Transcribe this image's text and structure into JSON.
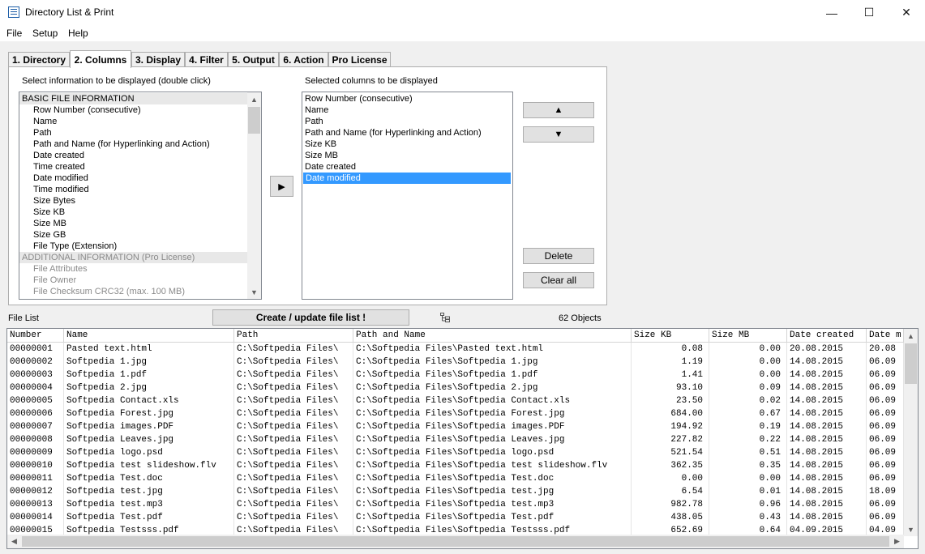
{
  "window": {
    "title": "Directory List & Print",
    "minimize": "—",
    "maximize": "☐",
    "close": "✕"
  },
  "menu": [
    "File",
    "Setup",
    "Help"
  ],
  "tabs": [
    "1. Directory",
    "2. Columns",
    "3. Display",
    "4. Filter",
    "5. Output",
    "6. Action",
    "Pro License"
  ],
  "columns_tab": {
    "available_label": "Select information to be displayed (double click)",
    "selected_label": "Selected columns to be displayed",
    "available": [
      "BASIC FILE INFORMATION",
      "Row Number (consecutive)",
      "Name",
      "Path",
      "Path and Name (for Hyperlinking and Action)",
      "Date created",
      "Time created",
      "Date modified",
      "Time modified",
      "Size Bytes",
      "Size KB",
      "Size MB",
      "Size GB",
      "File Type (Extension)",
      "ADDITIONAL INFORMATION (Pro License)",
      "File Attributes",
      "File Owner",
      "File Checksum CRC32 (max. 100 MB)"
    ],
    "selected": [
      "Row Number (consecutive)",
      "Name",
      "Path",
      "Path and Name (for Hyperlinking and Action)",
      "Size KB",
      "Size MB",
      "Date created",
      "Date modified"
    ],
    "selected_highlight": "Date modified",
    "add_button": "▶",
    "up_button": "▲",
    "down_button": "▼",
    "delete_button": "Delete",
    "clear_button": "Clear all"
  },
  "file_list": {
    "label": "File List",
    "create_button": "Create / update file list !",
    "count": "62 Objects",
    "headers": [
      "Number",
      "Name",
      "Path",
      "Path and Name",
      "Size KB",
      "Size MB",
      "Date created",
      "Date m"
    ],
    "rows": [
      [
        "00000001",
        "Pasted text.html",
        "C:\\Softpedia Files\\",
        "C:\\Softpedia Files\\Pasted text.html",
        "0.08",
        "0.00",
        "20.08.2015",
        "20.08"
      ],
      [
        "00000002",
        "Softpedia 1.jpg",
        "C:\\Softpedia Files\\",
        "C:\\Softpedia Files\\Softpedia 1.jpg",
        "1.19",
        "0.00",
        "14.08.2015",
        "06.09"
      ],
      [
        "00000003",
        "Softpedia 1.pdf",
        "C:\\Softpedia Files\\",
        "C:\\Softpedia Files\\Softpedia 1.pdf",
        "1.41",
        "0.00",
        "14.08.2015",
        "06.09"
      ],
      [
        "00000004",
        "Softpedia 2.jpg",
        "C:\\Softpedia Files\\",
        "C:\\Softpedia Files\\Softpedia 2.jpg",
        "93.10",
        "0.09",
        "14.08.2015",
        "06.09"
      ],
      [
        "00000005",
        "Softpedia Contact.xls",
        "C:\\Softpedia Files\\",
        "C:\\Softpedia Files\\Softpedia Contact.xls",
        "23.50",
        "0.02",
        "14.08.2015",
        "06.09"
      ],
      [
        "00000006",
        "Softpedia Forest.jpg",
        "C:\\Softpedia Files\\",
        "C:\\Softpedia Files\\Softpedia Forest.jpg",
        "684.00",
        "0.67",
        "14.08.2015",
        "06.09"
      ],
      [
        "00000007",
        "Softpedia images.PDF",
        "C:\\Softpedia Files\\",
        "C:\\Softpedia Files\\Softpedia images.PDF",
        "194.92",
        "0.19",
        "14.08.2015",
        "06.09"
      ],
      [
        "00000008",
        "Softpedia Leaves.jpg",
        "C:\\Softpedia Files\\",
        "C:\\Softpedia Files\\Softpedia Leaves.jpg",
        "227.82",
        "0.22",
        "14.08.2015",
        "06.09"
      ],
      [
        "00000009",
        "Softpedia logo.psd",
        "C:\\Softpedia Files\\",
        "C:\\Softpedia Files\\Softpedia logo.psd",
        "521.54",
        "0.51",
        "14.08.2015",
        "06.09"
      ],
      [
        "00000010",
        "Softpedia test slideshow.flv",
        "C:\\Softpedia Files\\",
        "C:\\Softpedia Files\\Softpedia test slideshow.flv",
        "362.35",
        "0.35",
        "14.08.2015",
        "06.09"
      ],
      [
        "00000011",
        "Softpedia Test.doc",
        "C:\\Softpedia Files\\",
        "C:\\Softpedia Files\\Softpedia Test.doc",
        "0.00",
        "0.00",
        "14.08.2015",
        "06.09"
      ],
      [
        "00000012",
        "Softpedia test.jpg",
        "C:\\Softpedia Files\\",
        "C:\\Softpedia Files\\Softpedia test.jpg",
        "6.54",
        "0.01",
        "14.08.2015",
        "18.09"
      ],
      [
        "00000013",
        "Softpedia test.mp3",
        "C:\\Softpedia Files\\",
        "C:\\Softpedia Files\\Softpedia test.mp3",
        "982.78",
        "0.96",
        "14.08.2015",
        "06.09"
      ],
      [
        "00000014",
        "Softpedia Test.pdf",
        "C:\\Softpedia Files\\",
        "C:\\Softpedia Files\\Softpedia Test.pdf",
        "438.05",
        "0.43",
        "14.08.2015",
        "06.09"
      ],
      [
        "00000015",
        "Softpedia Testsss.pdf",
        "C:\\Softpedia Files\\",
        "C:\\Softpedia Files\\Softpedia Testsss.pdf",
        "652.69",
        "0.64",
        "04.09.2015",
        "04.09"
      ]
    ]
  },
  "colors": {
    "selection": "#3399ff",
    "button_face": "#e1e1e1",
    "window_bg": "#f0f0f0"
  }
}
